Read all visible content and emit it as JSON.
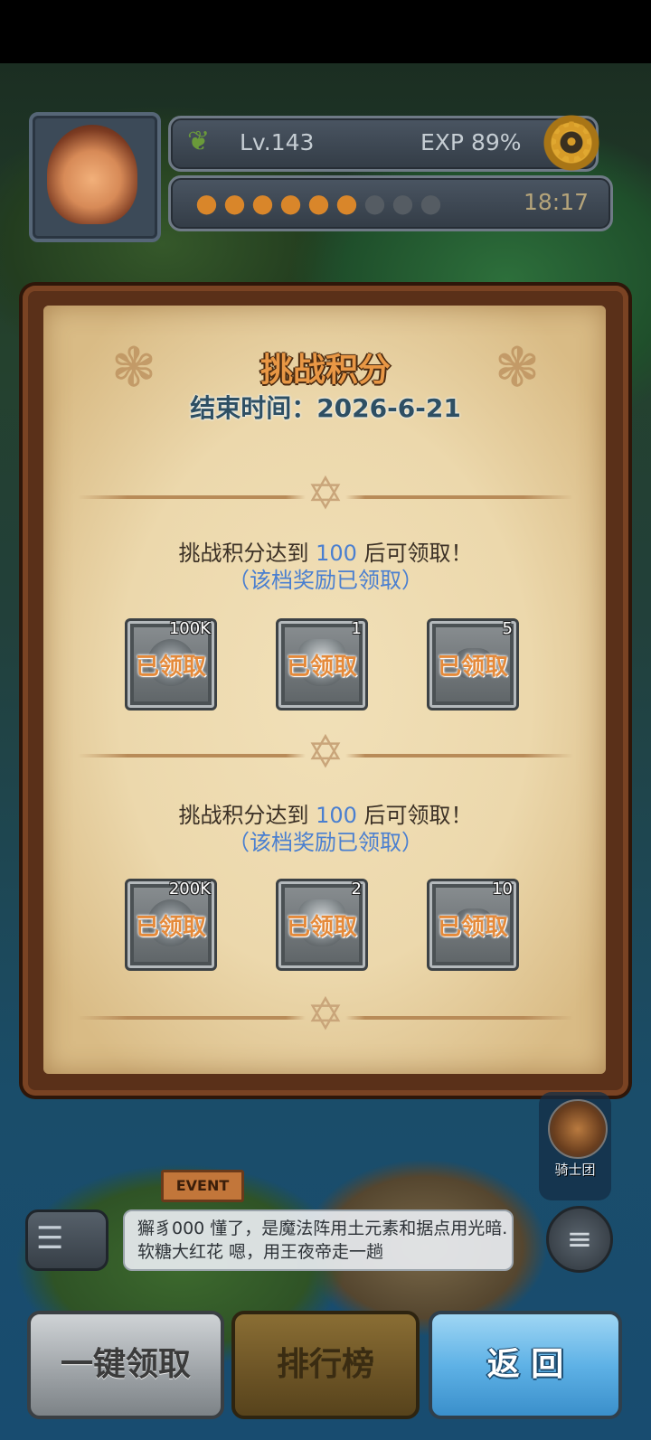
{
  "hud": {
    "level": "Lv.143",
    "exp": "EXP 89%",
    "timer": "18:17",
    "energy": {
      "filled": 6,
      "total": 9
    }
  },
  "panel": {
    "title": "挑战积分",
    "end_time": "结束时间：2026-6-21",
    "tiers": [
      {
        "requirement_prefix": "挑战积分达到",
        "requirement_value": "100",
        "requirement_suffix": "后可领取！",
        "status": "（该档奖励已领取）",
        "rewards": [
          {
            "count": "100K",
            "icon": "coin-icon",
            "state": "已领取"
          },
          {
            "count": "1",
            "icon": "pot-icon",
            "state": "已领取"
          },
          {
            "count": "5",
            "icon": "ore-icon",
            "state": "已领取"
          }
        ]
      },
      {
        "requirement_prefix": "挑战积分达到",
        "requirement_value": "100",
        "requirement_suffix": "后可领取！",
        "status": "（该档奖励已领取）",
        "rewards": [
          {
            "count": "200K",
            "icon": "coin-icon",
            "state": "已领取"
          },
          {
            "count": "2",
            "icon": "pot-icon",
            "state": "已领取"
          },
          {
            "count": "10",
            "icon": "ore-icon",
            "state": "已领取"
          }
        ]
      }
    ]
  },
  "map": {
    "knight_label": "骑士团",
    "event_sign": "EVENT"
  },
  "chat": {
    "lines": [
      "獬豸000  懂了，是魔法阵用土元素和据点用光暗...",
      "软糖大红花  嗯，用王夜帝走一趟"
    ]
  },
  "buttons": {
    "claim_all": "一键领取",
    "ranking": "排行榜",
    "back": "返 回"
  },
  "colors": {
    "title": "#e89745",
    "accent_blue": "#4a7fd0",
    "claimed_stamp": "#e58a3a"
  }
}
